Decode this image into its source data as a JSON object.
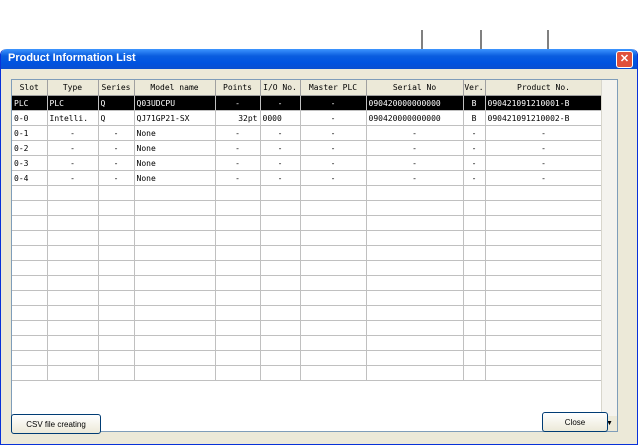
{
  "window": {
    "title": "Product Information List"
  },
  "columns": [
    "Slot",
    "Type",
    "Series",
    "Model name",
    "Points",
    "I/O No.",
    "Master PLC",
    "Serial No",
    "Ver.",
    "Product No."
  ],
  "rows": [
    [
      "PLC",
      "PLC",
      "Q",
      "Q03UDCPU",
      "-",
      "-",
      "-",
      "090420000000000",
      "B",
      "090421091210001-B"
    ],
    [
      "0-0",
      "Intelli.",
      "Q",
      "QJ71GP21-SX",
      "32pt",
      "0000",
      "-",
      "090420000000000",
      "B",
      "090421091210002-B"
    ],
    [
      "0-1",
      "-",
      "-",
      "None",
      "-",
      "-",
      "-",
      "-",
      "-",
      "-"
    ],
    [
      "0-2",
      "-",
      "-",
      "None",
      "-",
      "-",
      "-",
      "-",
      "-",
      "-"
    ],
    [
      "0-3",
      "-",
      "-",
      "None",
      "-",
      "-",
      "-",
      "-",
      "-",
      "-"
    ],
    [
      "0-4",
      "-",
      "-",
      "None",
      "-",
      "-",
      "-",
      "-",
      "-",
      "-"
    ]
  ],
  "selected_row": 0,
  "buttons": {
    "csv": "CSV file creating",
    "close": "Close"
  },
  "icons": {
    "close": "close-x-icon",
    "scroll_down": "scroll-down-arrow-icon"
  }
}
